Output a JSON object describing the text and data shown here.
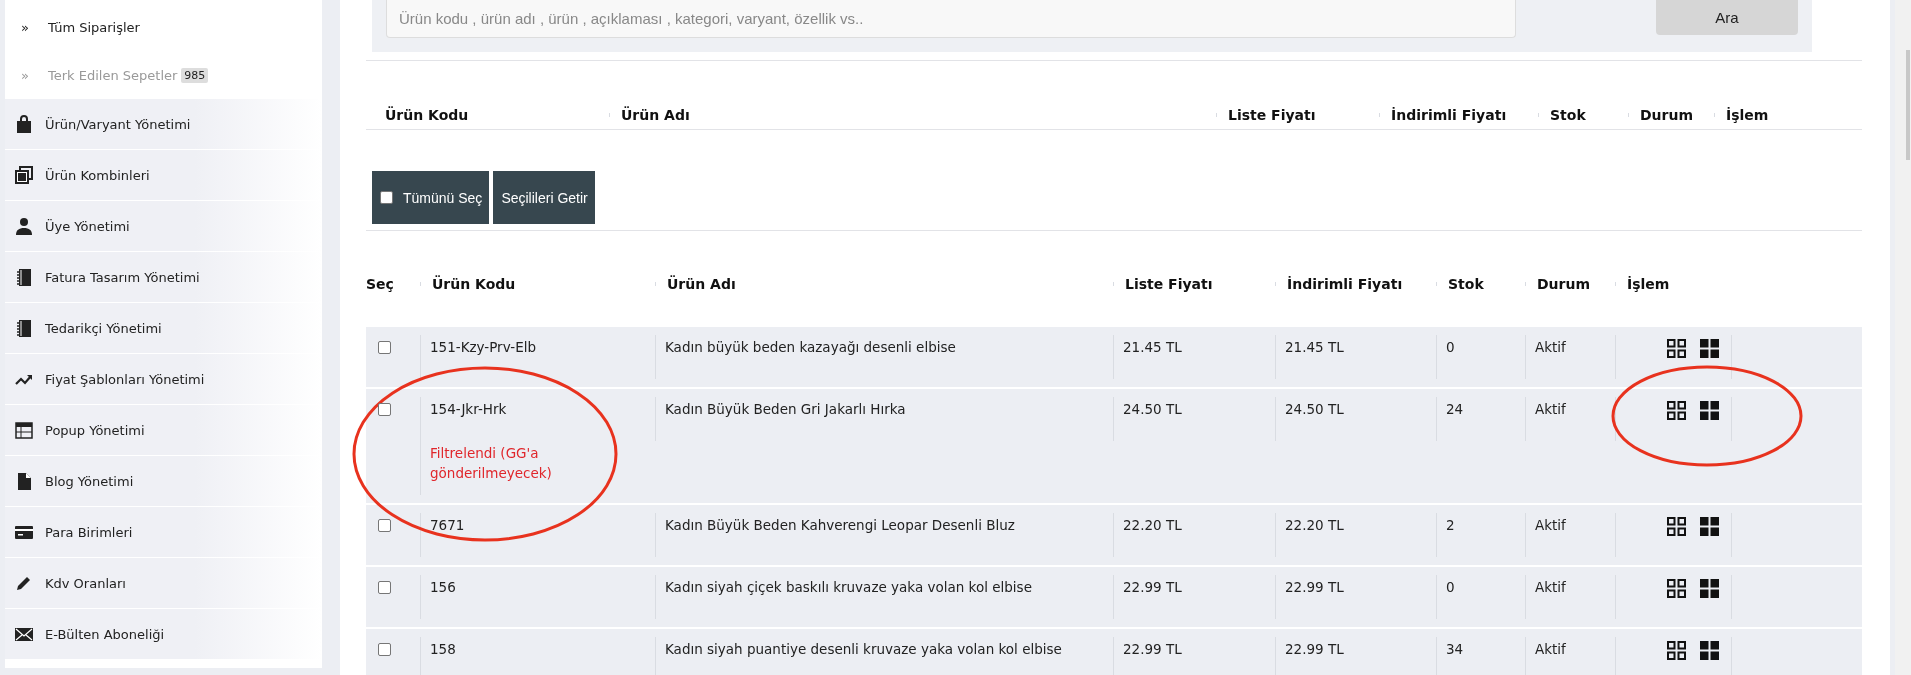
{
  "sidebar": {
    "sub_items": [
      {
        "arrow": "»",
        "label": "Tüm Siparişler",
        "muted": false
      },
      {
        "arrow": "»",
        "label": "Terk Edilen Sepetler",
        "muted": true,
        "badge": "985"
      }
    ],
    "items": [
      {
        "label": "Ürün/Varyant Yönetimi"
      },
      {
        "label": "Ürün Kombinleri"
      },
      {
        "label": "Üye Yönetimi"
      },
      {
        "label": "Fatura Tasarım Yönetimi"
      },
      {
        "label": "Tedarikçi Yönetimi"
      },
      {
        "label": "Fiyat Şablonları Yönetimi"
      },
      {
        "label": "Popup Yönetimi"
      },
      {
        "label": "Blog Yönetimi"
      },
      {
        "label": "Para Birimleri"
      },
      {
        "label": "Kdv Oranları"
      },
      {
        "label": "E-Bülten Aboneliği"
      }
    ]
  },
  "search": {
    "placeholder": "Ürün kodu , ürün adı , ürün , açıklaması , kategori, varyant, özellik vs..",
    "button": "Ara"
  },
  "filter_table": {
    "columns": [
      "Ürün Kodu",
      "Ürün Adı",
      "Liste Fiyatı",
      "İndirimli Fiyatı",
      "Stok",
      "Durum",
      "İşlem"
    ]
  },
  "bulk_actions": {
    "select_all": {
      "label": "Tümünü Seç",
      "checked": false
    },
    "fetch_button": "Seçilileri Getir"
  },
  "product_table": {
    "columns": [
      "Seç",
      "Ürün Kodu",
      "Ürün Adı",
      "Liste Fiyatı",
      "İndirimli Fiyatı",
      "Stok",
      "Durum",
      "İşlem"
    ],
    "rows": [
      {
        "checked": false,
        "code": "151-Kzy-Prv-Elb",
        "name": "Kadın büyük beden kazayağı desenli elbise",
        "list_price": "21.45 TL",
        "discount_price": "21.45 TL",
        "stock": "0",
        "status": "Aktif"
      },
      {
        "checked": false,
        "code": "154-Jkr-Hrk",
        "note": "Filtrelendi (GG'a gönderilmeyecek)",
        "name": "Kadın Büyük Beden Gri Jakarlı Hırka",
        "list_price": "24.50 TL",
        "discount_price": "24.50 TL",
        "stock": "24",
        "status": "Aktif"
      },
      {
        "checked": false,
        "code": "7671",
        "name": "Kadın Büyük Beden Kahverengi Leopar Desenli Bluz",
        "list_price": "22.20 TL",
        "discount_price": "22.20 TL",
        "stock": "2",
        "status": "Aktif"
      },
      {
        "checked": false,
        "code": "156",
        "name": "Kadın siyah çiçek baskılı kruvaze yaka volan kol elbise",
        "list_price": "22.99 TL",
        "discount_price": "22.99 TL",
        "stock": "0",
        "status": "Aktif"
      },
      {
        "checked": false,
        "code": "158",
        "name": "Kadın siyah puantiye desenli kruvaze yaka volan kol elbise",
        "list_price": "22.99 TL",
        "discount_price": "22.99 TL",
        "stock": "34",
        "status": "Aktif"
      }
    ]
  }
}
